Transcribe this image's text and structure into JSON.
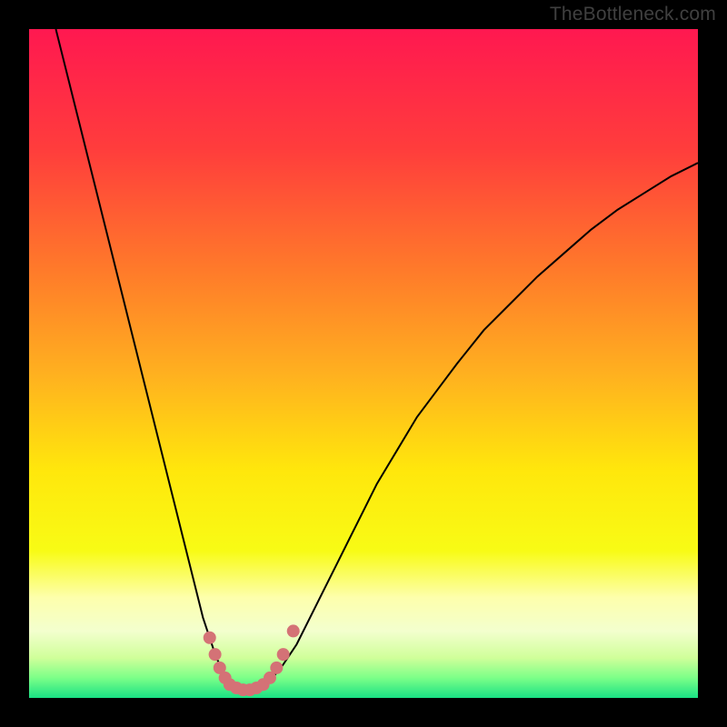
{
  "watermark": "TheBottleneck.com",
  "chart_data": {
    "type": "line",
    "title": "",
    "xlabel": "",
    "ylabel": "",
    "xlim": [
      0,
      100
    ],
    "ylim": [
      0,
      100
    ],
    "background_gradient": {
      "stops": [
        {
          "offset": 0.0,
          "color": "#ff1850"
        },
        {
          "offset": 0.18,
          "color": "#ff3d3c"
        },
        {
          "offset": 0.36,
          "color": "#ff7a2a"
        },
        {
          "offset": 0.52,
          "color": "#ffb21f"
        },
        {
          "offset": 0.66,
          "color": "#ffe70c"
        },
        {
          "offset": 0.78,
          "color": "#f8fb15"
        },
        {
          "offset": 0.85,
          "color": "#fdffac"
        },
        {
          "offset": 0.9,
          "color": "#f3ffce"
        },
        {
          "offset": 0.94,
          "color": "#d0ff9a"
        },
        {
          "offset": 0.97,
          "color": "#7cff88"
        },
        {
          "offset": 1.0,
          "color": "#19e184"
        }
      ]
    },
    "series": [
      {
        "name": "bottleneck-curve",
        "color": "#000000",
        "stroke_width": 2,
        "x": [
          4,
          5,
          6,
          7,
          8,
          9,
          10,
          11,
          12,
          13,
          14,
          15,
          16,
          17,
          18,
          19,
          20,
          21,
          22,
          23,
          24,
          25,
          26,
          27,
          28,
          29,
          30,
          31,
          32,
          33,
          34,
          35,
          36,
          38,
          40,
          42,
          44,
          46,
          48,
          50,
          52,
          55,
          58,
          61,
          64,
          68,
          72,
          76,
          80,
          84,
          88,
          92,
          96,
          100
        ],
        "y": [
          100,
          96,
          92,
          88,
          84,
          80,
          76,
          72,
          68,
          64,
          60,
          56,
          52,
          48,
          44,
          40,
          36,
          32,
          28,
          24,
          20,
          16,
          12,
          9,
          6,
          4,
          2.5,
          1.5,
          1,
          1,
          1,
          1.5,
          2.5,
          5,
          8,
          12,
          16,
          20,
          24,
          28,
          32,
          37,
          42,
          46,
          50,
          55,
          59,
          63,
          66.5,
          70,
          73,
          75.5,
          78,
          80
        ]
      }
    ],
    "marker_points": {
      "name": "highlight-markers",
      "color": "#d47276",
      "radius": 7,
      "points": [
        {
          "x": 27.0,
          "y": 9.0
        },
        {
          "x": 27.8,
          "y": 6.5
        },
        {
          "x": 28.5,
          "y": 4.5
        },
        {
          "x": 29.3,
          "y": 3.0
        },
        {
          "x": 30.0,
          "y": 2.0
        },
        {
          "x": 31.0,
          "y": 1.5
        },
        {
          "x": 32.0,
          "y": 1.2
        },
        {
          "x": 33.0,
          "y": 1.2
        },
        {
          "x": 34.0,
          "y": 1.5
        },
        {
          "x": 35.0,
          "y": 2.0
        },
        {
          "x": 36.0,
          "y": 3.0
        },
        {
          "x": 37.0,
          "y": 4.5
        },
        {
          "x": 38.0,
          "y": 6.5
        },
        {
          "x": 39.5,
          "y": 10.0
        }
      ]
    },
    "frame": {
      "color": "#000000",
      "thickness_px": 32
    }
  }
}
